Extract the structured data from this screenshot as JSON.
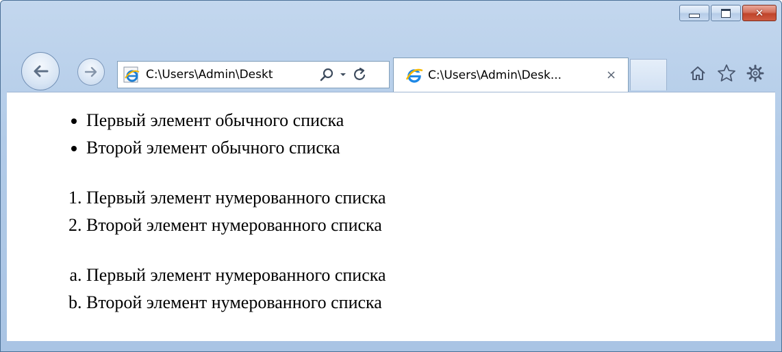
{
  "window": {
    "caption_buttons": {
      "minimize": "minimize-icon",
      "maximize": "maximize-icon",
      "close": "close-icon"
    },
    "colors": {
      "frame": "#b2cbe8",
      "close": "#c0442a"
    }
  },
  "toolbar": {
    "back_icon": "back-arrow-icon",
    "forward_icon": "forward-arrow-icon",
    "address": "C:\\Users\\Admin\\Deskt",
    "search_icon": "search-icon",
    "dropdown_icon": "dropdown-arrow-icon",
    "refresh_icon": "refresh-icon"
  },
  "tab": {
    "title": "C:\\Users\\Admin\\Desk...",
    "close_glyph": "×"
  },
  "right_toolbar": {
    "home_icon": "home-icon",
    "favorites_icon": "star-icon",
    "tools_icon": "gear-icon"
  },
  "content": {
    "unordered_list": [
      "Первый элемент обычного списка",
      "Второй элемент обычного списка"
    ],
    "numbered_list": [
      "Первый элемент нумерованного списка",
      "Второй элемент нумерованного списка"
    ],
    "lettered_list": [
      "Первый элемент нумерованного списка",
      "Второй элемент нумерованного списка"
    ]
  }
}
